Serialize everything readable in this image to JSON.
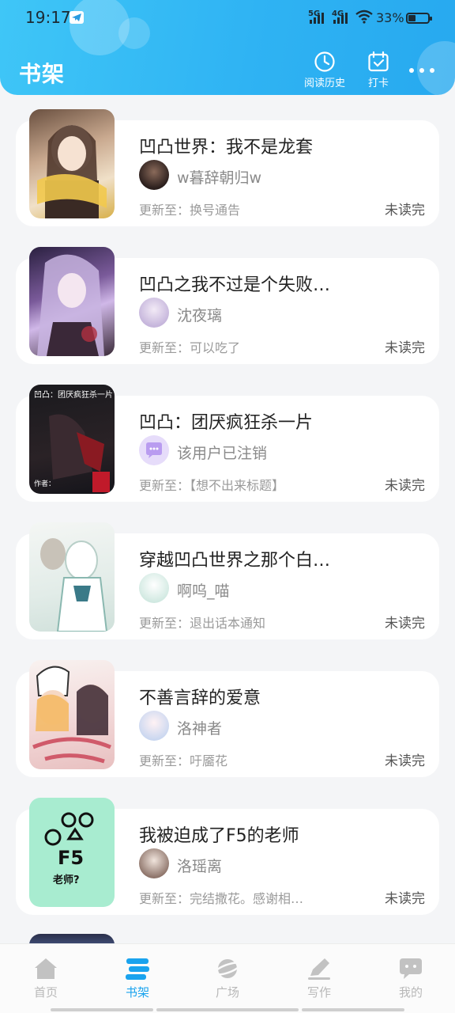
{
  "status_bar": {
    "time": "19:17",
    "network1": "5G",
    "network2": "4G",
    "battery": "33%"
  },
  "header": {
    "title": "书架",
    "history_label": "阅读历史",
    "checkin_label": "打卡"
  },
  "books": [
    {
      "title": "凹凸世界：我不是龙套",
      "author": "w暮辞朝归w",
      "update": "更新至：换号通告",
      "status": "未读完"
    },
    {
      "title": "凹凸之我不过是个失败…",
      "author": "沈夜璃",
      "update": "更新至：可以吃了",
      "status": "未读完"
    },
    {
      "title": "凹凸：团厌疯狂杀一片",
      "author": "该用户已注销",
      "update": "更新至：【想不出来标题】",
      "status": "未读完",
      "cover_text": "凹凸：团厌疯狂杀一片",
      "cover_author": "作者："
    },
    {
      "title": "穿越凹凸世界之那个白…",
      "author": "啊呜_喵",
      "update": "更新至：退出话本通知",
      "status": "未读完"
    },
    {
      "title": "不善言辞的爱意",
      "author": "洛神者",
      "update": "更新至：吁靥花",
      "status": "未读完"
    },
    {
      "title": "我被迫成了F5的老师",
      "author": "洛瑶离",
      "update": "更新至：完结撒花。感谢相…",
      "status": "未读完"
    }
  ],
  "tabs": [
    {
      "label": "首页",
      "icon": "home-icon"
    },
    {
      "label": "书架",
      "icon": "bookshelf-icon"
    },
    {
      "label": "广场",
      "icon": "planet-icon"
    },
    {
      "label": "写作",
      "icon": "pen-icon"
    },
    {
      "label": "我的",
      "icon": "chat-bubble-icon"
    }
  ],
  "colors": {
    "accent": "#1aa3ee",
    "header_start": "#3fc6f7",
    "header_end": "#27a9ef"
  }
}
